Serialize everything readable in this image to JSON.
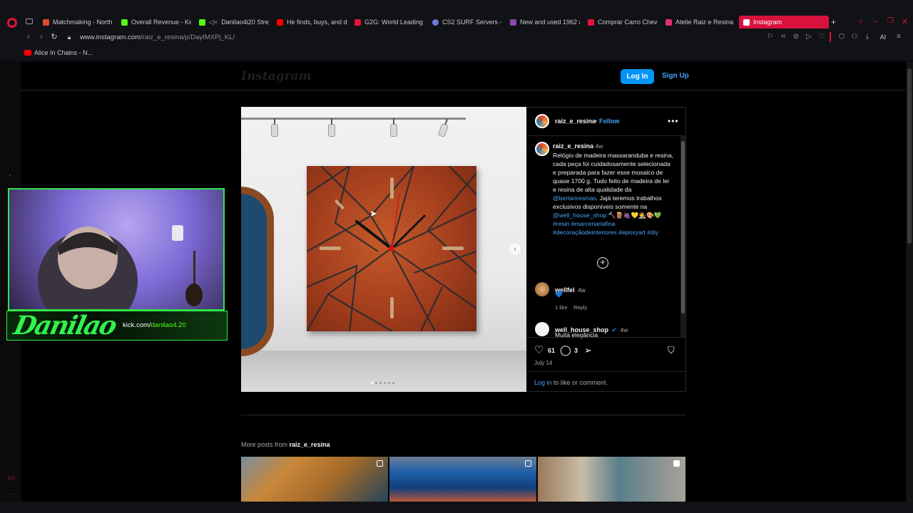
{
  "browser": {
    "tabs": [
      {
        "label": "Matchmaking - North",
        "color": "#e24b2b"
      },
      {
        "label": "Overall Revenue - Kic",
        "color": "#53fc18"
      },
      {
        "label": "Danilao4i20 Strea",
        "color": "#53fc18"
      },
      {
        "label": "He finds, buys, and d",
        "color": "#ff0000"
      },
      {
        "label": "G2G: World Leading D",
        "color": "#e8123b"
      },
      {
        "label": "CS2 SURF Servers - C",
        "color": "#6b7bd8"
      },
      {
        "label": "New and used 1962 a",
        "color": "#8e44ad"
      },
      {
        "label": "Comprar Carro Chev",
        "color": "#e8123b"
      },
      {
        "label": "Atelie Raiz e Resina (@",
        "color": "#e1306c"
      },
      {
        "label": "Instagram",
        "color": "#e1306c"
      }
    ],
    "url_prefix": "www.instagram.com",
    "url_path": "/raiz_e_resina/p/DayIMXPj_KL/",
    "bookmark": "Alice In Chains - N...",
    "toolbar_ai": "AI"
  },
  "instagram": {
    "logo": "Instagram",
    "login_label": "Log In",
    "signup_label": "Sign Up",
    "post": {
      "author": "raiz_e_resina",
      "follow_label": "Follow",
      "follow_sep": "•",
      "more_label": "•••",
      "caption_author": "raiz_e_resina",
      "caption_age": "4w",
      "caption_text_1": "Relógio de madeira massaranduba e resina, cada peça foi cuidadosamente selecionada e preparada para fazer esse mosaico de quase 1700 g. Tudo feito de madeira de lei e resina de alta qualidade da ",
      "caption_mention_1": "@bertanresinas",
      "caption_text_2": ". Jajá teremos trabalhos exclusivos disponíveis somente na ",
      "caption_mention_2": "@well_house_shop",
      "caption_emojis": " 🔨🪵🍇💛🧑‍🎨🎨💚",
      "caption_hashtags": "#resin #marcenariafina #decoraçãodeinteriores #epoxyart #diy",
      "plus_label": "+",
      "comments": [
        {
          "user": "wellfel",
          "age": "4w",
          "text": "💙",
          "likes": "1 like",
          "reply": "Reply"
        },
        {
          "user": "well_house_shop",
          "age": "4w",
          "text": "Muita elegância"
        }
      ],
      "likes_count": "61",
      "comments_count": "3",
      "date": "July 14",
      "login_link": "Log in",
      "login_suffix": " to like or comment."
    },
    "more_posts_prefix": "More posts from ",
    "more_posts_user": "raiz_e_resina"
  },
  "stream_overlay": {
    "streamer_name": "Danilao",
    "kick_prefix": "kick.com/",
    "kick_user": "danilao4.20"
  }
}
